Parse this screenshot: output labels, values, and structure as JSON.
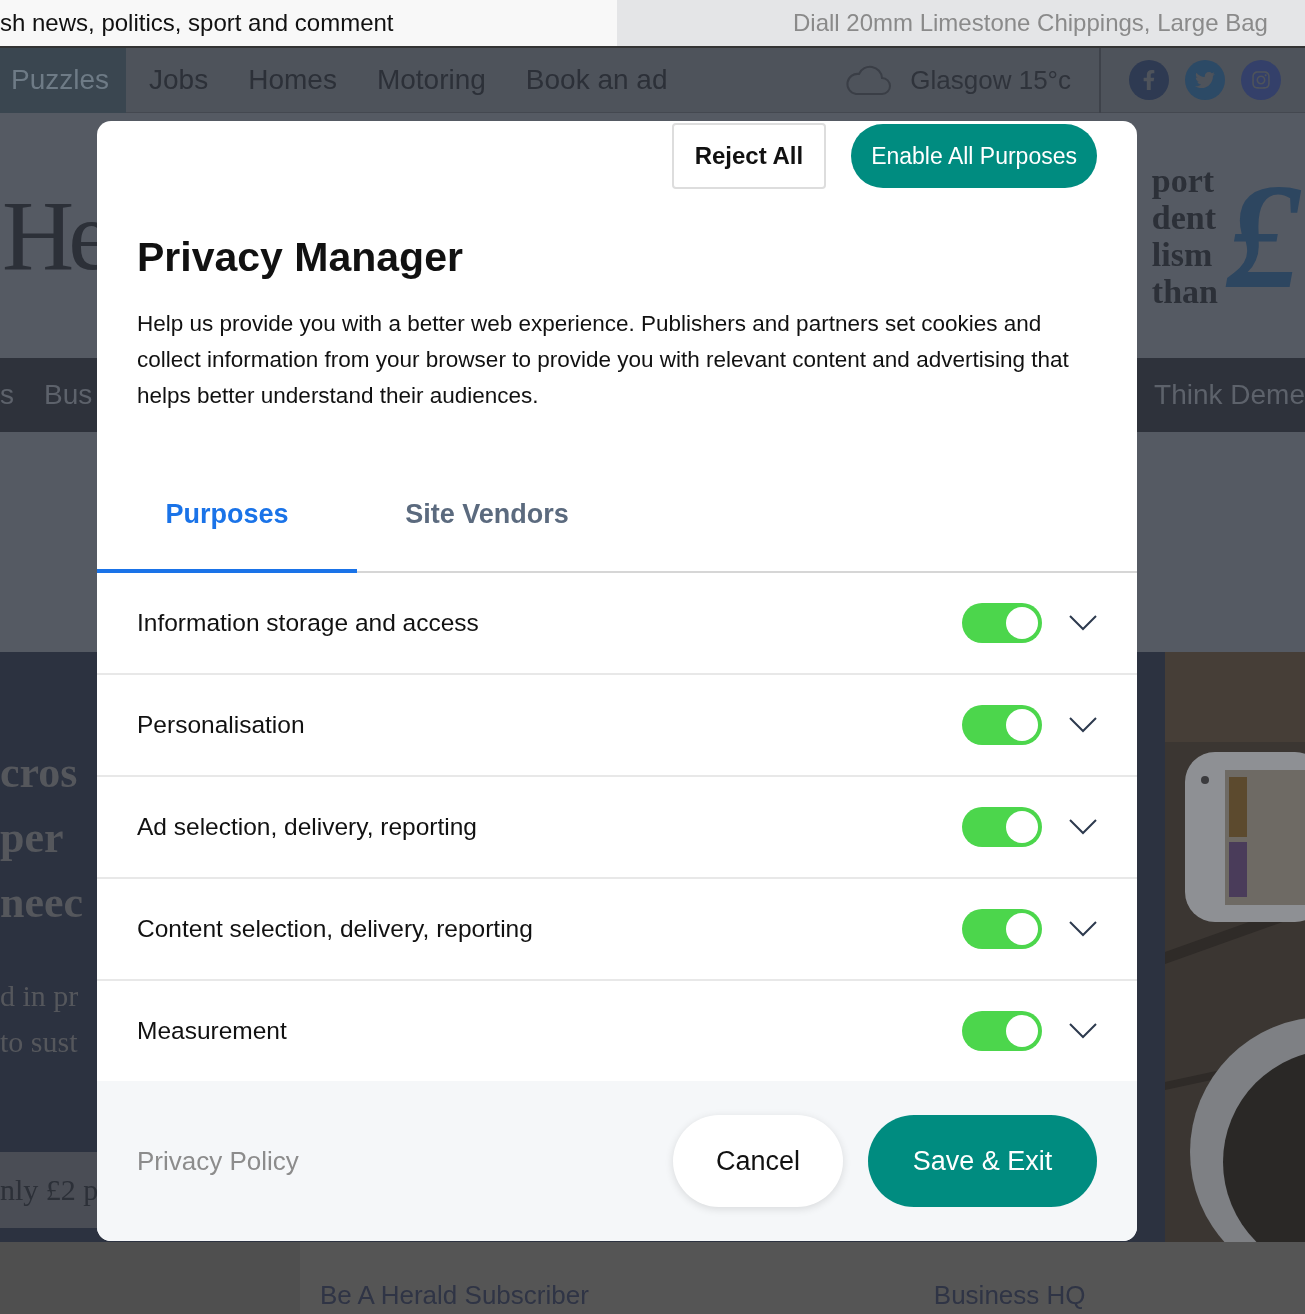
{
  "browser_tabs": [
    {
      "title": "sh news, politics, sport and comment",
      "selected": true
    },
    {
      "title": "Diall 20mm Limestone Chippings, Large Bag",
      "selected": false
    }
  ],
  "site_nav": {
    "items": [
      {
        "label": "Puzzles",
        "selected": true
      },
      {
        "label": "Jobs",
        "selected": false
      },
      {
        "label": "Homes",
        "selected": false
      },
      {
        "label": "Motoring",
        "selected": false
      },
      {
        "label": "Book an ad",
        "selected": false
      }
    ],
    "weather": "Glasgow 15°c"
  },
  "masthead": {
    "logo": "He",
    "promo_lines": [
      "port",
      "dent",
      "lism",
      "than"
    ],
    "promo_symbol": "£"
  },
  "section_nav": {
    "left": [
      "s",
      "Bus"
    ],
    "right": "Think Deme"
  },
  "feature": {
    "headline_lines": [
      "cros",
      "per",
      "neec"
    ],
    "body_lines": [
      "d in pr",
      "to sust"
    ],
    "price_banner": "nly £2 p",
    "image": {
      "kind": "picture"
    }
  },
  "footer_links": [
    "Be A Herald Subscriber",
    "Business HQ"
  ],
  "dialog": {
    "reject_button": "Reject All",
    "enable_button": "Enable All Purposes",
    "title": "Privacy Manager",
    "description": "Help us provide you with a better web experience. Publishers and partners set cookies and collect information from your browser to provide you with relevant content and advertising that helps better understand their audiences.",
    "tabs": [
      {
        "label": "Purposes",
        "selected": true
      },
      {
        "label": "Site Vendors",
        "selected": false
      }
    ],
    "purposes": [
      {
        "label": "Information storage and access",
        "on": true,
        "expanded": false
      },
      {
        "label": "Personalisation",
        "on": true,
        "expanded": false
      },
      {
        "label": "Ad selection, delivery, reporting",
        "on": true,
        "expanded": false
      },
      {
        "label": "Content selection, delivery, reporting",
        "on": true,
        "expanded": false
      },
      {
        "label": "Measurement",
        "on": true,
        "expanded": false
      }
    ],
    "privacy_link": "Privacy Policy",
    "cancel_button": "Cancel",
    "save_button": "Save & Exit"
  }
}
